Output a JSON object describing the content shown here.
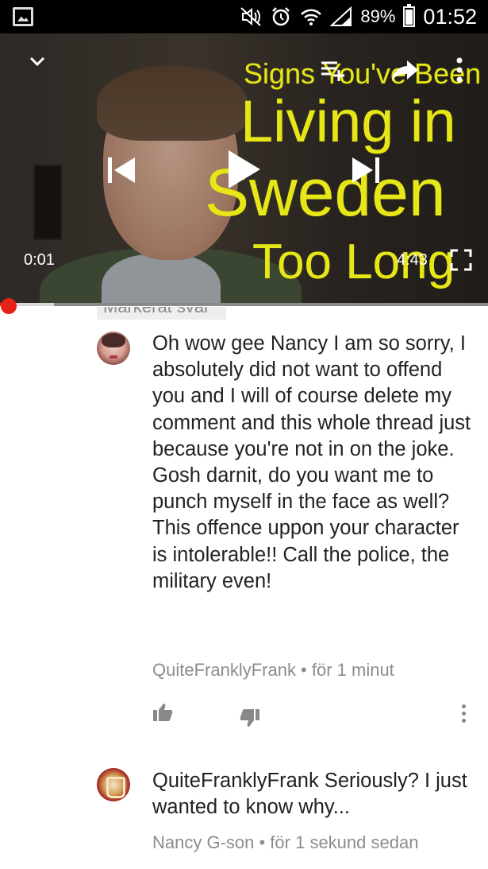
{
  "status_bar": {
    "battery": "89%",
    "time": "01:52",
    "icons": [
      "gallery-icon",
      "mute-icon",
      "alarm-icon",
      "wifi-icon",
      "signal-icon",
      "battery-icon"
    ]
  },
  "player": {
    "title_lines": [
      "Signs You've Been",
      "Living in",
      "Sweden",
      "Too Long"
    ],
    "current_time": "0:01",
    "duration": "4:43",
    "progress_fraction": 0.004,
    "buffered_fraction": 0.11,
    "icons": [
      "chevron-down-icon",
      "add-to-queue-icon",
      "share-icon",
      "more-vert-icon",
      "previous-icon",
      "play-icon",
      "next-icon",
      "fullscreen-icon"
    ],
    "colors": {
      "title": "#e6e619",
      "progress": "#e62117"
    }
  },
  "marked_tag": "Markerat svar",
  "comments": [
    {
      "text": "Oh wow gee Nancy I am so sorry, I absolutely did not want to offend you and I will of course delete my comment and this whole thread just because you're not in on the joke. Gosh darnit, do you want me to punch myself in the face as well? This offence uppon your character is intolerable!! Call the police, the military even!",
      "author": "QuiteFranklyFrank",
      "time": "för 1 minut",
      "meta": "QuiteFranklyFrank • för 1 minut"
    },
    {
      "text": "QuiteFranklyFrank Seriously? I just wanted to know why...",
      "author": "Nancy G-son",
      "time": "för 1 sekund sedan",
      "meta": "Nancy G-son • för 1 sekund sedan"
    }
  ],
  "actions": [
    "thumbs-up-icon",
    "thumbs-down-icon",
    "more-vert-icon"
  ]
}
